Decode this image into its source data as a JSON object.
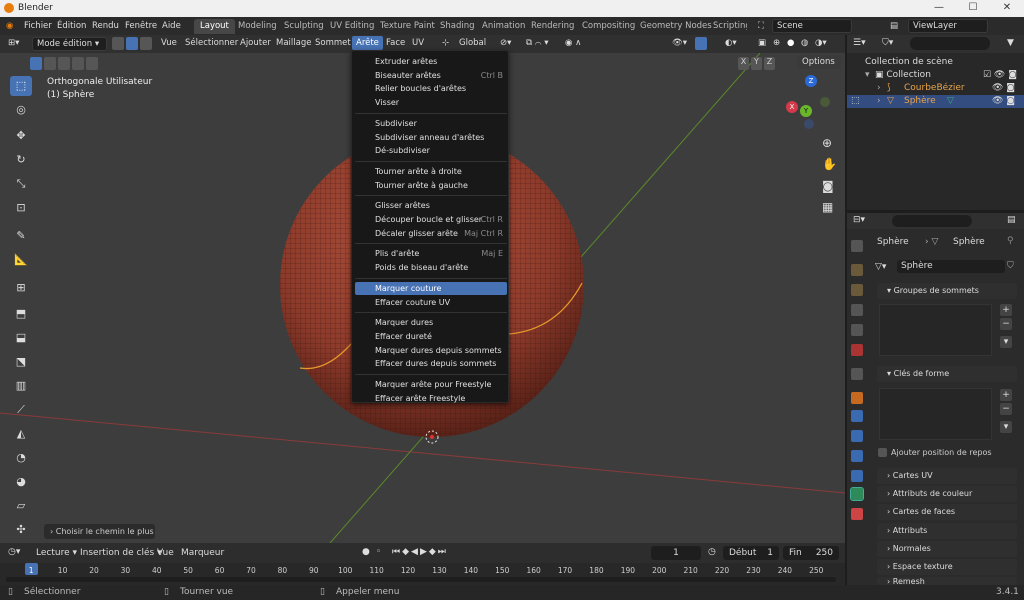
{
  "window": {
    "title": "Blender",
    "minimize": "—",
    "maximize": "☐",
    "close": "✕"
  },
  "menubar": {
    "menus": [
      "Fichier",
      "Édition",
      "Rendu",
      "Fenêtre",
      "Aide"
    ],
    "workspaces": [
      "Layout",
      "Modeling",
      "Sculpting",
      "UV Editing",
      "Texture Paint",
      "Shading",
      "Animation",
      "Rendering",
      "Compositing",
      "Geometry Nodes",
      "Scripting"
    ],
    "scene": "Scene",
    "view_layer": "ViewLayer"
  },
  "viewport_header": {
    "mode": "Mode édition",
    "menus": [
      "Vue",
      "Sélectionner",
      "Ajouter",
      "Maillage",
      "Sommet",
      "Arête",
      "Face",
      "UV"
    ],
    "transform": "Global",
    "options": "Options",
    "axes": [
      "X",
      "Y",
      "Z"
    ]
  },
  "viewport": {
    "view_name": "Orthogonale Utilisateur",
    "object_name": "(1) Sphère",
    "gizmo": {
      "x": "X",
      "y": "Y",
      "z": "Z"
    },
    "last_op": "Choisir le chemin le plus c",
    "sphere_color": "#8c3a2a",
    "seam_color": "#e89a2a"
  },
  "edge_menu": {
    "groups": [
      [
        {
          "label": "Extruder arêtes",
          "shortcut": ""
        },
        {
          "label": "Biseauter arêtes",
          "shortcut": "Ctrl B"
        },
        {
          "label": "Relier boucles d'arêtes",
          "shortcut": ""
        },
        {
          "label": "Visser",
          "shortcut": ""
        }
      ],
      [
        {
          "label": "Subdiviser",
          "shortcut": ""
        },
        {
          "label": "Subdiviser anneau d'arêtes",
          "shortcut": ""
        },
        {
          "label": "Dé-subdiviser",
          "shortcut": ""
        }
      ],
      [
        {
          "label": "Tourner arête à droite",
          "shortcut": ""
        },
        {
          "label": "Tourner arête à gauche",
          "shortcut": ""
        }
      ],
      [
        {
          "label": "Glisser arêtes",
          "shortcut": ""
        },
        {
          "label": "Découper boucle et glisser",
          "shortcut": "Ctrl R"
        },
        {
          "label": "Décaler glisser arête",
          "shortcut": "Maj Ctrl R"
        }
      ],
      [
        {
          "label": "Plis d'arête",
          "shortcut": "Maj E"
        },
        {
          "label": "Poids de biseau d'arête",
          "shortcut": ""
        }
      ],
      [
        {
          "label": "Marquer couture",
          "shortcut": ""
        },
        {
          "label": "Effacer couture UV",
          "shortcut": ""
        }
      ],
      [
        {
          "label": "Marquer dures",
          "shortcut": ""
        },
        {
          "label": "Effacer dureté",
          "shortcut": ""
        },
        {
          "label": "Marquer dures depuis sommets",
          "shortcut": ""
        },
        {
          "label": "Effacer dures depuis sommets",
          "shortcut": ""
        }
      ],
      [
        {
          "label": "Marquer arête pour Freestyle",
          "shortcut": ""
        },
        {
          "label": "Effacer arête Freestyle",
          "shortcut": ""
        }
      ]
    ],
    "highlighted": "Marquer couture"
  },
  "outliner": {
    "root": "Collection de scène",
    "collection": "Collection",
    "items": [
      {
        "name": "CourbeBézier",
        "color": "#e8a44a"
      },
      {
        "name": "Sphère",
        "color": "#e8a44a"
      }
    ]
  },
  "properties": {
    "breadcrumb_obj": "Sphère",
    "breadcrumb_data": "Sphère",
    "mesh_name": "Sphère",
    "sections": {
      "vertex_groups": "Groupes de sommets",
      "shape_keys": "Clés de forme",
      "relative": "Ajouter position de repos",
      "uv_maps": "Cartes UV",
      "color_attrs": "Attributs de couleur",
      "face_maps": "Cartes de faces",
      "attributes": "Attributs",
      "normals": "Normales",
      "texture_space": "Espace texture",
      "remesh": "Remesh"
    }
  },
  "timeline": {
    "menus": [
      "Lecture",
      "Insertion de clés",
      "Vue",
      "Marqueur"
    ],
    "current_frame": "1",
    "start_label": "Début",
    "start": "1",
    "end_label": "Fin",
    "end": "250",
    "ticks": [
      "1",
      "10",
      "20",
      "30",
      "40",
      "50",
      "60",
      "70",
      "80",
      "90",
      "100",
      "110",
      "120",
      "130",
      "140",
      "150",
      "160",
      "170",
      "180",
      "190",
      "200",
      "210",
      "220",
      "230",
      "240",
      "250"
    ]
  },
  "status": {
    "select": "Sélectionner",
    "rotate": "Tourner vue",
    "menu": "Appeler menu",
    "version": "3.4.1"
  }
}
